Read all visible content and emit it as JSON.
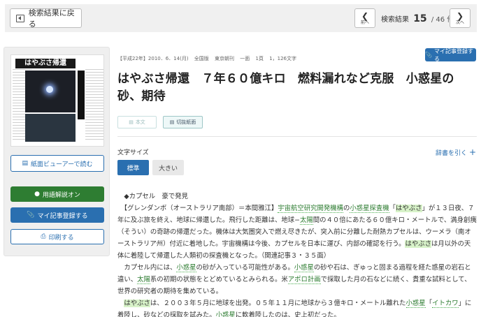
{
  "topbar": {
    "back_label": "検索結果に戻る",
    "prev_label": "前へ",
    "next_label": "次へ",
    "result_label": "検索結果",
    "current": "15",
    "total": "/ 46 件"
  },
  "sidebar": {
    "thumb_headline": "はやぶさ帰還",
    "viewer_label": "紙面ビューアーで読む",
    "glossary_label": "用語解説オン",
    "register_label": "マイ記事登録する",
    "print_label": "印刷する"
  },
  "article": {
    "meta": [
      "【平成22年】2010．6．14(月)",
      "全国版",
      "東京朝刊",
      "一面",
      "1頁",
      "1，126文字"
    ],
    "register_label": "マイ記事登録する",
    "title": "はやぶさ帰還　７年６０億キロ　燃料漏れなど克服　小惑星の砂、期待",
    "tab_text": "本文",
    "tab_clip": "切抜紙面",
    "font_size_label": "文字サイズ",
    "dict_label": "辞書を引く",
    "fs_standard": "標準",
    "fs_large": "大きい",
    "body": [
      "　◆カプセル　豪で発見",
      "　【グレンダンボ（オーストラリア南部）＝本間雅江】宇宙航空研究開発機構の小惑星探査機「はやぶさ」が１３日夜、７年に及ぶ旅を終え、地球に帰還した。飛行した距離は、地球−太陽間の４０倍にあたる６０億キロ・メートルで、満身創痍（そうい）の奇跡の帰還だった。機体は大気圏突入で燃え尽きたが、突入前に分離した耐熱カプセルは、ウーメラ（南オーストラリア州）付近に着地した。宇宙機構は今後、カプセルを日本に運び、内部の確認を行う。はやぶさは月以外の天体に着陸して帰還した人類初の探査機となった。（関連記事３・３５面）",
      "　カプセル内には、小惑星の砂が入っている可能性がある。小惑星の砂や石は、ぎゅっと固まる過程を経た惑星の岩石と違い、太陽系の初期の状態をとどめているとみられる。米アポロ計画で採取した月の石などに続く、貴重な試料として、世界の研究者の期待を集めている。",
      "　はやぶさは、２００３年５月に地球を出発。０５年１１月に地球から３億キロ・メートル離れた小惑星「イトカワ」に着陸し、砂などの採取を試みた。小惑星に軟着陸したのは、史上初だった。"
    ]
  },
  "colors": {
    "accent_blue": "#2a6fb0",
    "accent_green": "#2e7d32",
    "highlight": "#d8f3c9"
  }
}
